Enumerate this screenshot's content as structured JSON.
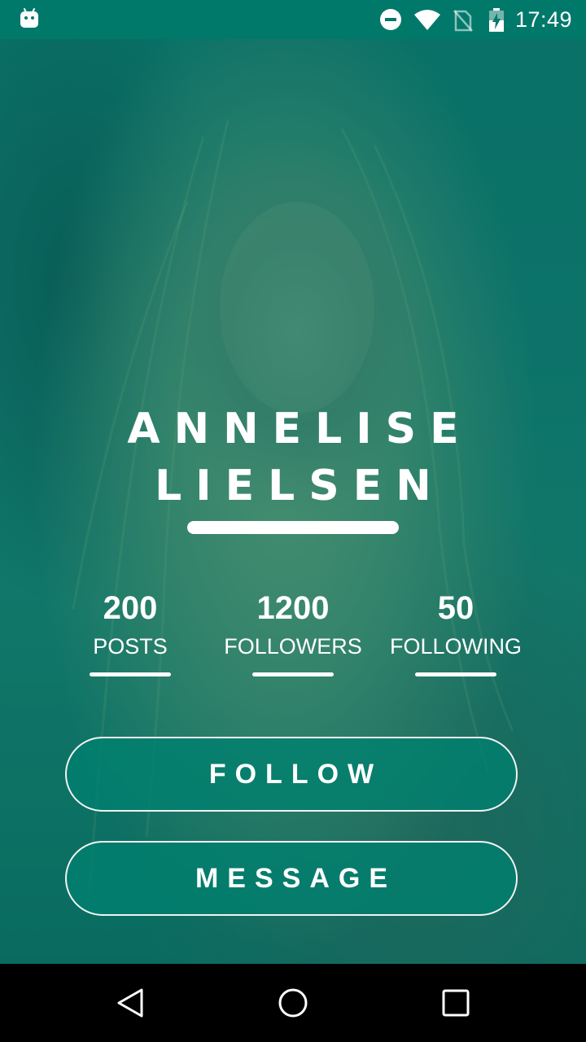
{
  "status_bar": {
    "time": "17:49",
    "icons": [
      "android-icon",
      "dnd-icon",
      "wifi-icon",
      "no-sim-icon",
      "battery-charging-icon"
    ]
  },
  "profile": {
    "first_name": "ANNELISE",
    "last_name": "LIELSEN"
  },
  "stats": {
    "posts": {
      "count": "200",
      "label": "POSTS"
    },
    "followers": {
      "count": "1200",
      "label": "FOLLOWERS"
    },
    "following": {
      "count": "50",
      "label": "FOLLOWING"
    }
  },
  "actions": {
    "follow_label": "FOLLOW",
    "message_label": "MESSAGE"
  },
  "nav_bar": {
    "icons": [
      "back-icon",
      "home-icon",
      "recents-icon"
    ]
  },
  "colors": {
    "primary": "#00796b",
    "overlay": "#008070",
    "text": "#ffffff"
  }
}
